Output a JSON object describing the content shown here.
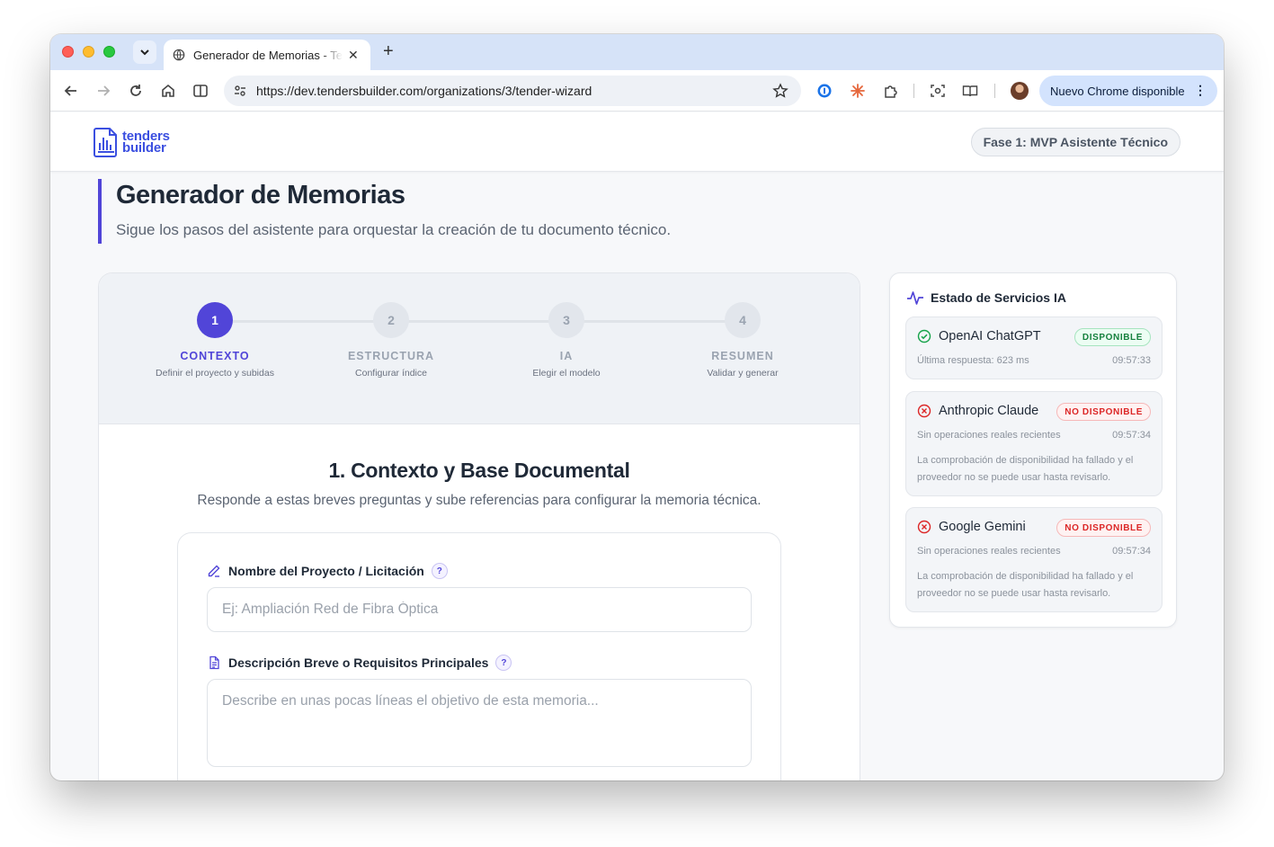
{
  "browser": {
    "tab_title": "Generador de Memorias - Tenders Builder",
    "url": "https://dev.tendersbuilder.com/organizations/3/tender-wizard",
    "update_chip": "Nuevo Chrome disponible"
  },
  "header": {
    "logo_line1": "tenders",
    "logo_line2": "builder",
    "phase": "Fase 1: MVP Asistente Técnico"
  },
  "page": {
    "title": "Generador de Memorias",
    "subtitle": "Sigue los pasos del asistente para orquestar la creación de tu documento técnico."
  },
  "steps": [
    {
      "number": "1",
      "name": "CONTEXTO",
      "desc": "Definir el proyecto y subidas",
      "active": true
    },
    {
      "number": "2",
      "name": "ESTRUCTURA",
      "desc": "Configurar índice",
      "active": false
    },
    {
      "number": "3",
      "name": "IA",
      "desc": "Elegir el modelo",
      "active": false
    },
    {
      "number": "4",
      "name": "RESUMEN",
      "desc": "Validar y generar",
      "active": false
    }
  ],
  "section": {
    "title": "1. Contexto y Base Documental",
    "subtitle": "Responde a estas breves preguntas y sube referencias para configurar la memoria técnica."
  },
  "form": {
    "project_label": "Nombre del Proyecto / Licitación",
    "project_placeholder": "Ej: Ampliación Red de Fibra Óptica",
    "description_label": "Descripción Breve o Requisitos Principales",
    "description_placeholder": "Describe en unas pocas líneas el objetivo de esta memoria...",
    "help": "?"
  },
  "status": {
    "title": "Estado de Servicios IA",
    "services": [
      {
        "name": "OpenAI ChatGPT",
        "badge": "DISPONIBLE",
        "ok": true,
        "meta": "Última respuesta: 623 ms",
        "time": "09:57:33",
        "error": ""
      },
      {
        "name": "Anthropic Claude",
        "badge": "NO DISPONIBLE",
        "ok": false,
        "meta": "Sin operaciones reales recientes",
        "time": "09:57:34",
        "error": "La comprobación de disponibilidad ha fallado y el proveedor no se puede usar hasta revisarlo."
      },
      {
        "name": "Google Gemini",
        "badge": "NO DISPONIBLE",
        "ok": false,
        "meta": "Sin operaciones reales recientes",
        "time": "09:57:34",
        "error": "La comprobación de disponibilidad ha fallado y el proveedor no se puede usar hasta revisarlo."
      }
    ]
  },
  "colors": {
    "accent": "#5145d8",
    "brand": "#3b4fe0",
    "ok": "#15803d",
    "error": "#dc2626"
  }
}
